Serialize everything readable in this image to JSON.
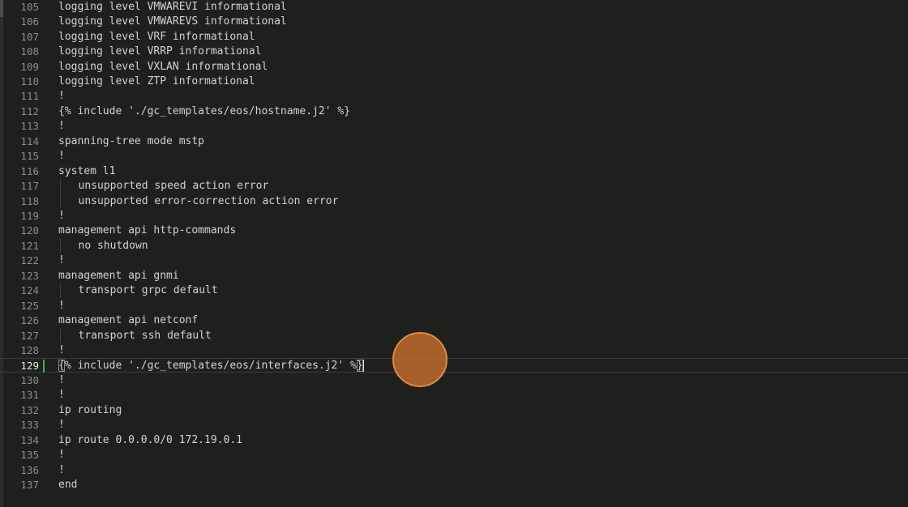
{
  "editor": {
    "active_line": 129,
    "lines": [
      {
        "n": "105",
        "text": "logging level VMWAREVI informational",
        "indent": 0
      },
      {
        "n": "106",
        "text": "logging level VMWAREVS informational",
        "indent": 0
      },
      {
        "n": "107",
        "text": "logging level VRF informational",
        "indent": 0
      },
      {
        "n": "108",
        "text": "logging level VRRP informational",
        "indent": 0
      },
      {
        "n": "109",
        "text": "logging level VXLAN informational",
        "indent": 0
      },
      {
        "n": "110",
        "text": "logging level ZTP informational",
        "indent": 0
      },
      {
        "n": "111",
        "text": "!",
        "indent": 0
      },
      {
        "n": "112",
        "text": "{% include './gc_templates/eos/hostname.j2' %}",
        "indent": 0
      },
      {
        "n": "113",
        "text": "!",
        "indent": 0
      },
      {
        "n": "114",
        "text": "spanning-tree mode mstp",
        "indent": 0
      },
      {
        "n": "115",
        "text": "!",
        "indent": 0
      },
      {
        "n": "116",
        "text": "system l1",
        "indent": 0
      },
      {
        "n": "117",
        "text": "unsupported speed action error",
        "indent": 1
      },
      {
        "n": "118",
        "text": "unsupported error-correction action error",
        "indent": 1
      },
      {
        "n": "119",
        "text": "!",
        "indent": 0
      },
      {
        "n": "120",
        "text": "management api http-commands",
        "indent": 0
      },
      {
        "n": "121",
        "text": "no shutdown",
        "indent": 1
      },
      {
        "n": "122",
        "text": "!",
        "indent": 0
      },
      {
        "n": "123",
        "text": "management api gnmi",
        "indent": 0
      },
      {
        "n": "124",
        "text": "transport grpc default",
        "indent": 1
      },
      {
        "n": "125",
        "text": "!",
        "indent": 0
      },
      {
        "n": "126",
        "text": "management api netconf",
        "indent": 0
      },
      {
        "n": "127",
        "text": "transport ssh default",
        "indent": 1
      },
      {
        "n": "128",
        "text": "!",
        "indent": 0
      },
      {
        "n": "129",
        "text": "{% include './gc_templates/eos/interfaces.j2' %}",
        "indent": 0
      },
      {
        "n": "130",
        "text": "!",
        "indent": 0
      },
      {
        "n": "131",
        "text": "!",
        "indent": 0
      },
      {
        "n": "132",
        "text": "ip routing",
        "indent": 0
      },
      {
        "n": "133",
        "text": "!",
        "indent": 0
      },
      {
        "n": "134",
        "text": "ip route 0.0.0.0/0 172.19.0.1",
        "indent": 0
      },
      {
        "n": "135",
        "text": "!",
        "indent": 0
      },
      {
        "n": "136",
        "text": "!",
        "indent": 0
      },
      {
        "n": "137",
        "text": "end",
        "indent": 0
      }
    ]
  },
  "colors": {
    "background": "#1e201e",
    "text": "#d0d4d0",
    "line_number": "#8a8f8a",
    "modified_marker": "#3fae4b",
    "cursor_highlight": "#e08a3c"
  }
}
